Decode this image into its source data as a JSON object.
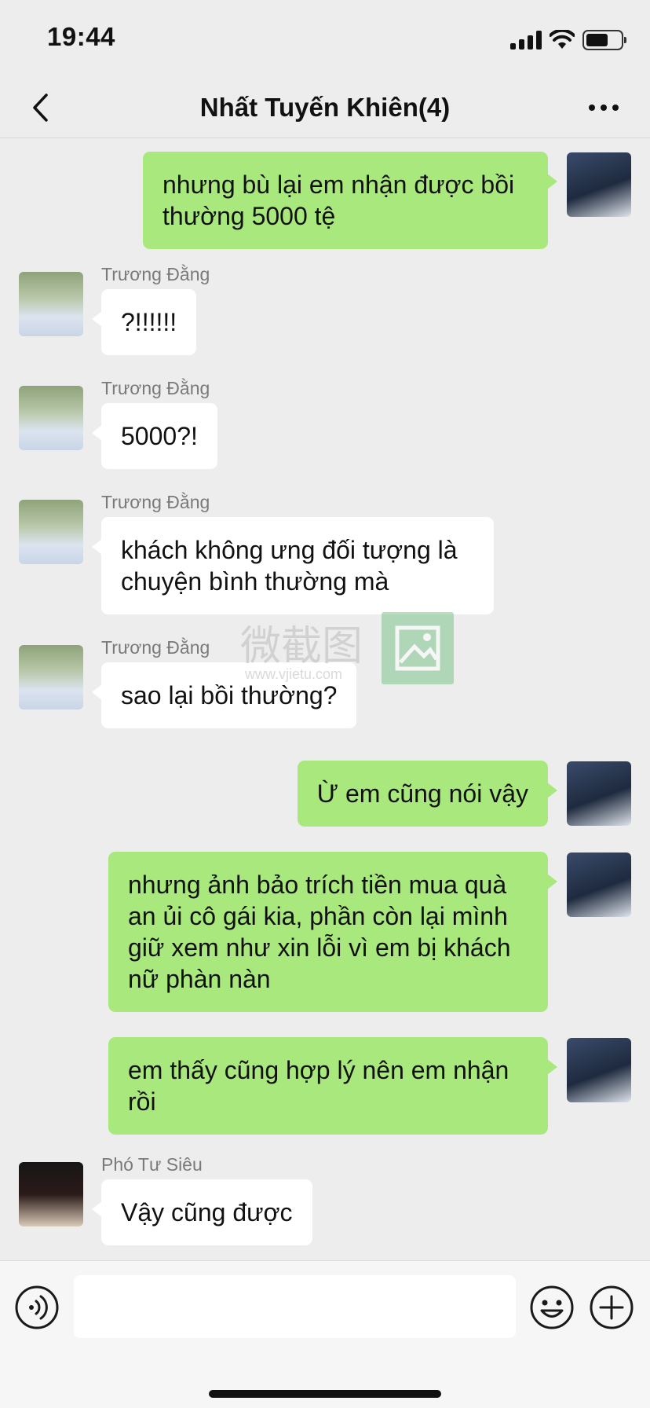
{
  "status": {
    "time": "19:44",
    "battery_level": 0.65
  },
  "nav": {
    "title": "Nhất Tuyến Khiên(4)",
    "back_icon": "chevron-left-icon",
    "more_icon": "ellipsis-icon"
  },
  "messages": [
    {
      "side": "out",
      "text": "nhưng bù lại em nhận được bồi thường 5000 tệ"
    },
    {
      "side": "in",
      "sender": "Trương Đằng",
      "text": "?!!!!!!"
    },
    {
      "side": "in",
      "sender": "Trương Đằng",
      "text": "5000?!"
    },
    {
      "side": "in",
      "sender": "Trương Đằng",
      "text": "khách không ưng đối tượng là chuyện bình thường mà"
    },
    {
      "side": "in",
      "sender": "Trương Đằng",
      "text": "sao lại bồi thường?"
    },
    {
      "side": "out",
      "text": "Ừ em cũng nói vậy"
    },
    {
      "side": "out",
      "text": "nhưng ảnh bảo trích tiền mua quà an ủi cô gái kia, phần còn lại mình giữ xem như xin lỗi vì em bị khách nữ phàn nàn"
    },
    {
      "side": "out",
      "text": "em thấy cũng hợp lý nên em nhận rồi"
    },
    {
      "side": "in",
      "sender": "Phó Tư Siêu",
      "text": "Vậy cũng được"
    }
  ],
  "watermark": {
    "text": "微截图",
    "url": "www.vjietu.com"
  },
  "input": {
    "placeholder": ""
  },
  "colors": {
    "outgoing_bubble": "#a9e87c",
    "incoming_bubble": "#ffffff",
    "background": "#ededed"
  }
}
